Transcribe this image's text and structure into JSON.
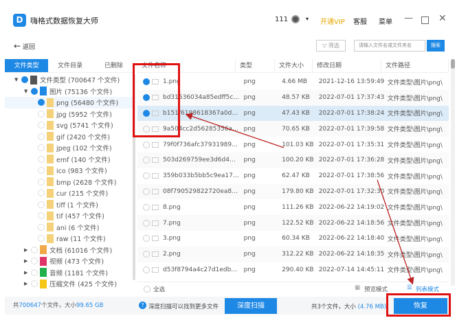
{
  "app": {
    "title": "嗨格式数据恢复大师",
    "user_id": "111",
    "vip": "开通VIP",
    "service": "客服",
    "menu": "菜单",
    "logo_letter": "D"
  },
  "toolbar": {
    "back": "返回",
    "filter": "筛选",
    "search_placeholder": "请输入文件名或文件夹名",
    "search_button": "搜索"
  },
  "tabs": [
    "文件类型",
    "文件目录",
    "已删除"
  ],
  "tree": [
    {
      "label": "文件类型 (700647 个文件)",
      "level": 0,
      "expanded": true,
      "checked": "partial",
      "color": "#555"
    },
    {
      "label": "图片 (75136 个文件)",
      "level": 1,
      "expanded": true,
      "checked": "partial",
      "color": "#1e88e5"
    },
    {
      "label": "png (56480 个文件)",
      "level": 2,
      "checked": "partial",
      "color": "#f5d27a",
      "selected": true
    },
    {
      "label": "jpg (5952 个文件)",
      "level": 2,
      "color": "#f5d27a"
    },
    {
      "label": "svg (5741 个文件)",
      "level": 2,
      "color": "#f5d27a"
    },
    {
      "label": "gif (2420 个文件)",
      "level": 2,
      "color": "#f5d27a"
    },
    {
      "label": "jpeg (102 个文件)",
      "level": 2,
      "color": "#f5d27a"
    },
    {
      "label": "emf (140 个文件)",
      "level": 2,
      "color": "#f5d27a"
    },
    {
      "label": "ico (983 个文件)",
      "level": 2,
      "color": "#f5d27a"
    },
    {
      "label": "bmp (2628 个文件)",
      "level": 2,
      "color": "#f5d27a"
    },
    {
      "label": "cur (215 个文件)",
      "level": 2,
      "color": "#f5d27a"
    },
    {
      "label": "tiff (1 个文件)",
      "level": 2,
      "color": "#f5d27a"
    },
    {
      "label": "tif (457 个文件)",
      "level": 2,
      "color": "#f5d27a"
    },
    {
      "label": "ani (6 个文件)",
      "level": 2,
      "color": "#f5d27a"
    },
    {
      "label": "raw (11 个文件)",
      "level": 2,
      "color": "#f5d27a"
    },
    {
      "label": "文档 (61016 个文件)",
      "level": 1,
      "collapsed": true,
      "color": "#f0a94a"
    },
    {
      "label": "视频 (473 个文件)",
      "level": 1,
      "collapsed": true,
      "color": "#e0356a"
    },
    {
      "label": "音频 (1181 个文件)",
      "level": 1,
      "collapsed": true,
      "color": "#22b04b"
    },
    {
      "label": "压缩文件 (425 个文件)",
      "level": 1,
      "collapsed": true,
      "color": "#f5c518"
    }
  ],
  "left_footer": {
    "prefix": "共",
    "count": "700647",
    "mid": "个文件，大小",
    "size": "99.65 GB"
  },
  "columns": [
    "文件名称",
    "类型",
    "文件大小",
    "修改日期",
    "文件路径"
  ],
  "files": [
    {
      "name": "1.png",
      "type": "png",
      "size": "4.66 MB",
      "date": "2021-12-16 13:59:49",
      "path": "文件类型\\图片\\png\\",
      "checked": true
    },
    {
      "name": "bd31536034a85edff5c41...",
      "type": "png",
      "size": "48.57 KB",
      "date": "2022-07-01 17:37:43",
      "path": "文件类型\\图片\\png\\",
      "checked": true
    },
    {
      "name": "b151f6198618367a0d3d...",
      "type": "png",
      "size": "47.43 KB",
      "date": "2022-07-01 17:38:24",
      "path": "文件类型\\图片\\png\\",
      "checked": true,
      "selected": true
    },
    {
      "name": "9a504cc2d56285356ab7...",
      "type": "png",
      "size": "70.65 KB",
      "date": "2022-07-01 17:39:58",
      "path": "文件类型\\图片\\png\\"
    },
    {
      "name": "79f0f736afc3793198959...",
      "type": "png",
      "size": "101.03 KB",
      "date": "2022-07-01 17:35:31",
      "path": "文件类型\\图片\\png\\"
    },
    {
      "name": "503d269759ee3d6d4185...",
      "type": "png",
      "size": "100.20 KB",
      "date": "2022-07-01 17:36:28",
      "path": "文件类型\\图片\\png\\"
    },
    {
      "name": "359b033b5bb5c9ea1756...",
      "type": "png",
      "size": "62.47 KB",
      "date": "2022-07-01 17:38:56",
      "path": "文件类型\\图片\\png\\"
    },
    {
      "name": "08f790529822720ea809...",
      "type": "png",
      "size": "179.80 KB",
      "date": "2022-07-01 17:32:30",
      "path": "文件类型\\图片\\png\\"
    },
    {
      "name": "8.png",
      "type": "png",
      "size": "111.26 KB",
      "date": "2022-06-22 14:19:02",
      "path": "文件类型\\图片\\png\\"
    },
    {
      "name": "7.png",
      "type": "png",
      "size": "122.52 KB",
      "date": "2022-06-22 14:18:56",
      "path": "文件类型\\图片\\png\\"
    },
    {
      "name": "3.png",
      "type": "png",
      "size": "60.34 KB",
      "date": "2022-06-22 14:18:40",
      "path": "文件类型\\图片\\png\\"
    },
    {
      "name": "2.png",
      "type": "png",
      "size": "312.22 KB",
      "date": "2022-06-22 14:18:35",
      "path": "文件类型\\图片\\png\\"
    },
    {
      "name": "d53f8794a4c27d1edb76...",
      "type": "png",
      "size": "290.40 KB",
      "date": "2022-07-14 14:45:11",
      "path": "文件类型\\图片\\png\\"
    }
  ],
  "table_footer": {
    "select_all": "全选",
    "preview_mode": "预览模式",
    "list_mode": "列表模式"
  },
  "bottom": {
    "hint": "深度扫描可以找到更多文件",
    "deep_scan": "深度扫描",
    "summary_prefix": "共3个文件，大小",
    "summary_size": "(4.76 MB)",
    "recover": "恢复"
  },
  "colors": {
    "accent": "#1e88e5",
    "annotation": "#e01010"
  }
}
